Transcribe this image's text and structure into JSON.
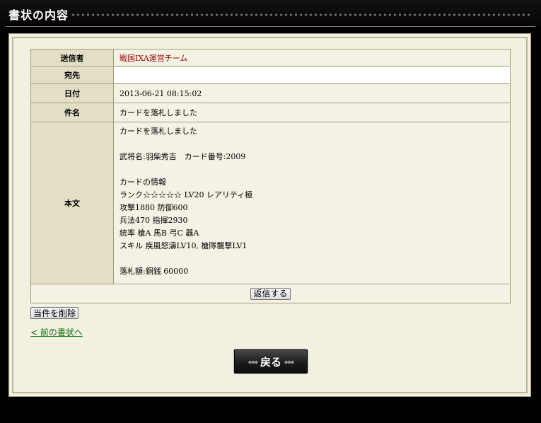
{
  "window": {
    "title": "書状の内容"
  },
  "mail": {
    "sender_label": "送信者",
    "sender_value": "戦国IXA運営チーム",
    "to_label": "宛先",
    "to_value": "",
    "date_label": "日付",
    "date_value": "2013-06-21 08:15:02",
    "subject_label": "件名",
    "subject_value": "カードを落札しました",
    "body_label": "本文",
    "body_lines": [
      "カードを落札しました",
      "",
      "武将名:羽柴秀吉　カード番号:2009",
      "",
      "カードの情報",
      "ランク☆☆☆☆☆ LV20 レアリティ極",
      "攻撃1880 防御600",
      "兵法470 指揮2930",
      "統率 槍A 馬B 弓C 器A",
      "スキル 疾風怒濤LV10, 槍隊襲撃LV1",
      "",
      "落札額:銅銭 60000"
    ]
  },
  "actions": {
    "reply_label": "返信する",
    "delete_label": "当件を削除",
    "prev_link": "< 前の書状へ",
    "back_label": "戻る"
  },
  "colors": {
    "background": "#000000",
    "panel": "#f2f0e0",
    "label_cell": "#e3dfc6",
    "sender_text": "#990000",
    "link": "#0e6f0e"
  }
}
